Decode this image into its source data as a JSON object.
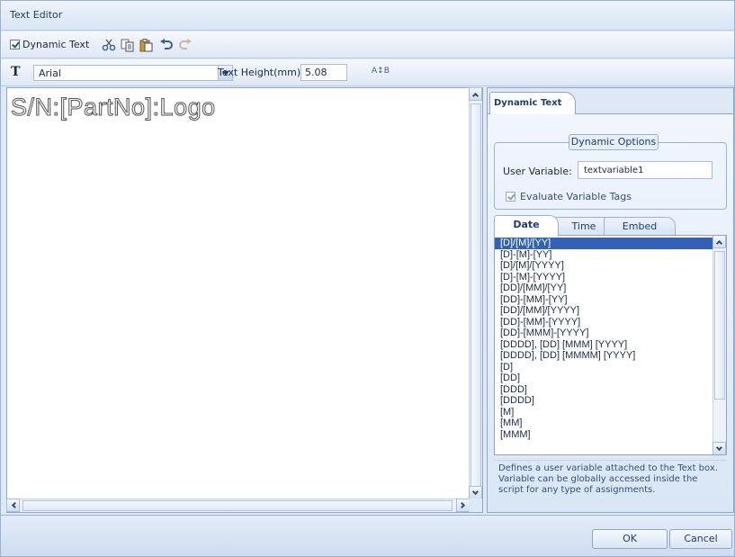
{
  "window": {
    "title": "Text Editor"
  },
  "toolbar": {
    "dynamic_text_label": "Dynamic Text",
    "dynamic_text_checked": true,
    "icons": [
      "cut-icon",
      "copy-icon",
      "paste-icon",
      "undo-icon",
      "redo-icon"
    ]
  },
  "format": {
    "font": "Arial",
    "font_icon_glyph": "T",
    "text_height_label": "Text Height(mm)",
    "text_height_value": "5.08",
    "font_size_icon_glyph": "A↕B"
  },
  "editor": {
    "content": "S/N:[PartNo]:Logo"
  },
  "panel": {
    "tab_label": "Dynamic Text",
    "options_title": "Dynamic Options",
    "user_variable_label": "User Variable:",
    "user_variable_value": "textvariable1",
    "evaluate_label": "Evaluate Variable Tags",
    "evaluate_checked": true,
    "subtabs": [
      "Date",
      "Time",
      "Embed"
    ],
    "active_subtab": "Date",
    "items": [
      "[D]/[M]/[YY]",
      "[D]-[M]-[YY]",
      "[D]/[M]/[YYYY]",
      "[D]-[M]-[YYYY]",
      "[DD]/[MM]/[YY]",
      "[DD]-[MM]-[YY]",
      "[DD]/[MM]/[YYYY]",
      "[DD]-[MM]-[YYYY]",
      "[DD]-[MMM]-[YYYY]",
      "[DDDD], [DD] [MMM] [YYYY]",
      "[DDDD], [DD] [MMMM] [YYYY]",
      "[D]",
      "[DD]",
      "[DDD]",
      "[DDDD]",
      "[M]",
      "[MM]",
      "[MMM]"
    ],
    "selected_index": 0,
    "description": "Defines a user variable attached to the Text box. Variable can be globally accessed inside the script for any type of assignments."
  },
  "buttons": {
    "ok": "OK",
    "cancel": "Cancel"
  },
  "colors": {
    "selection": "#3262b7",
    "frame": "#dfe9f6",
    "accent": "#1e3d6e"
  }
}
